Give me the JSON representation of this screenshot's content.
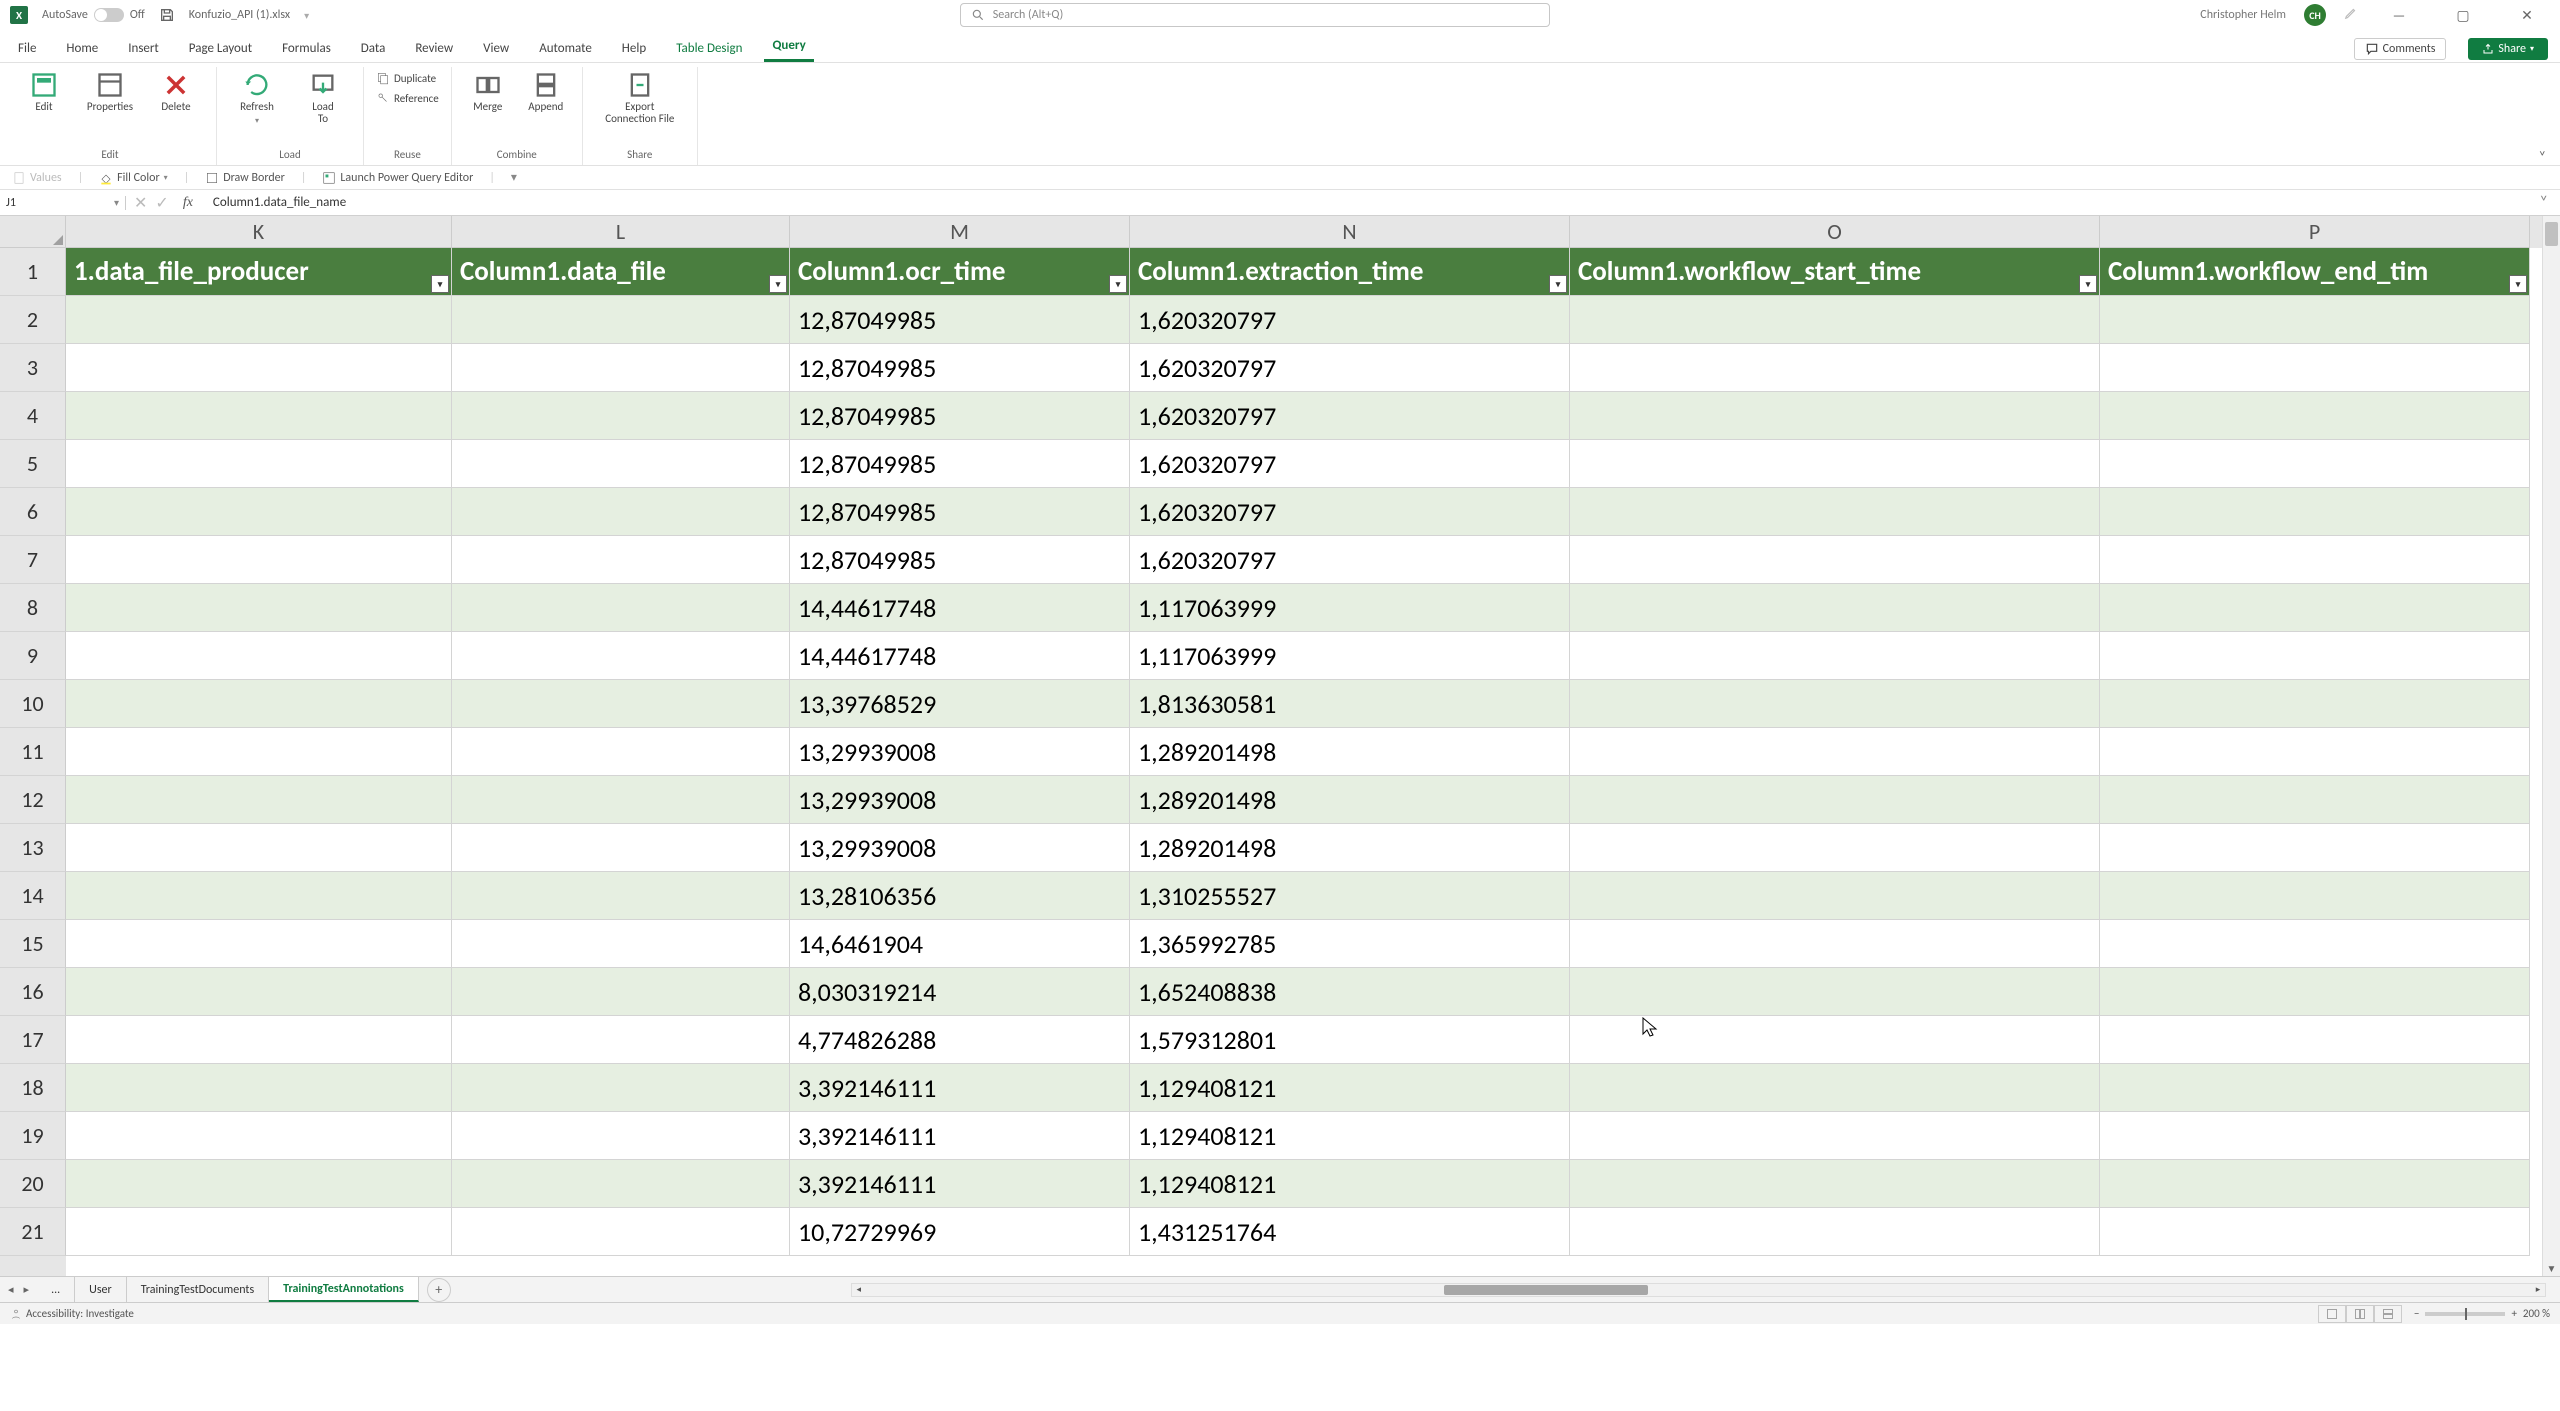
{
  "title": {
    "autosave": "AutoSave",
    "autosave_state": "Off",
    "filename": "Konfuzio_API (1).xlsx",
    "search_placeholder": "Search (Alt+Q)",
    "user": "Christopher Helm",
    "initials": "CH"
  },
  "tabs": {
    "items": [
      "File",
      "Home",
      "Insert",
      "Page Layout",
      "Formulas",
      "Data",
      "Review",
      "View",
      "Automate",
      "Help",
      "Table Design",
      "Query"
    ],
    "active": "Query",
    "comments": "Comments",
    "share": "Share"
  },
  "ribbon": {
    "edit": {
      "edit": "Edit",
      "properties": "Properties",
      "delete": "Delete",
      "label": "Edit"
    },
    "load": {
      "refresh": "Refresh",
      "loadto": "Load\nTo",
      "label": "Load"
    },
    "reuse": {
      "duplicate": "Duplicate",
      "reference": "Reference",
      "label": "Reuse"
    },
    "combine": {
      "merge": "Merge",
      "append": "Append",
      "label": "Combine"
    },
    "share": {
      "export": "Export\nConnection File",
      "label": "Share"
    }
  },
  "subbar": {
    "values": "Values",
    "fill": "Fill Color",
    "border": "Draw Border",
    "pq": "Launch Power Query Editor"
  },
  "fbar": {
    "name": "J1",
    "formula": "Column1.data_file_name"
  },
  "cols": {
    "widths": [
      386,
      338,
      340,
      440,
      530,
      430
    ],
    "letters": [
      "K",
      "L",
      "M",
      "N",
      "O",
      "P"
    ]
  },
  "headers": [
    "1.data_file_producer",
    "Column1.data_file",
    "Column1.ocr_time",
    "Column1.extraction_time",
    "Column1.workflow_start_time",
    "Column1.workflow_end_tim"
  ],
  "rows": [
    {
      "n": 2,
      "m": "12,87049985",
      "x": "1,620320797"
    },
    {
      "n": 3,
      "m": "12,87049985",
      "x": "1,620320797"
    },
    {
      "n": 4,
      "m": "12,87049985",
      "x": "1,620320797"
    },
    {
      "n": 5,
      "m": "12,87049985",
      "x": "1,620320797"
    },
    {
      "n": 6,
      "m": "12,87049985",
      "x": "1,620320797"
    },
    {
      "n": 7,
      "m": "12,87049985",
      "x": "1,620320797"
    },
    {
      "n": 8,
      "m": "14,44617748",
      "x": "1,117063999"
    },
    {
      "n": 9,
      "m": "14,44617748",
      "x": "1,117063999"
    },
    {
      "n": 10,
      "m": "13,39768529",
      "x": "1,813630581"
    },
    {
      "n": 11,
      "m": "13,29939008",
      "x": "1,289201498"
    },
    {
      "n": 12,
      "m": "13,29939008",
      "x": "1,289201498"
    },
    {
      "n": 13,
      "m": "13,29939008",
      "x": "1,289201498"
    },
    {
      "n": 14,
      "m": "13,28106356",
      "x": "1,310255527"
    },
    {
      "n": 15,
      "m": "14,6461904",
      "x": "1,365992785"
    },
    {
      "n": 16,
      "m": "8,030319214",
      "x": "1,652408838"
    },
    {
      "n": 17,
      "m": "4,774826288",
      "x": "1,579312801"
    },
    {
      "n": 18,
      "m": "3,392146111",
      "x": "1,129408121"
    },
    {
      "n": 19,
      "m": "3,392146111",
      "x": "1,129408121"
    },
    {
      "n": 20,
      "m": "3,392146111",
      "x": "1,129408121"
    },
    {
      "n": 21,
      "m": "10,72729969",
      "x": "1,431251764"
    }
  ],
  "sheets": {
    "items": [
      "...",
      "User",
      "TrainingTestDocuments",
      "TrainingTestAnnotations"
    ],
    "active": "TrainingTestAnnotations"
  },
  "status": {
    "accessibility": "Accessibility: Investigate",
    "zoom": "200 %"
  }
}
